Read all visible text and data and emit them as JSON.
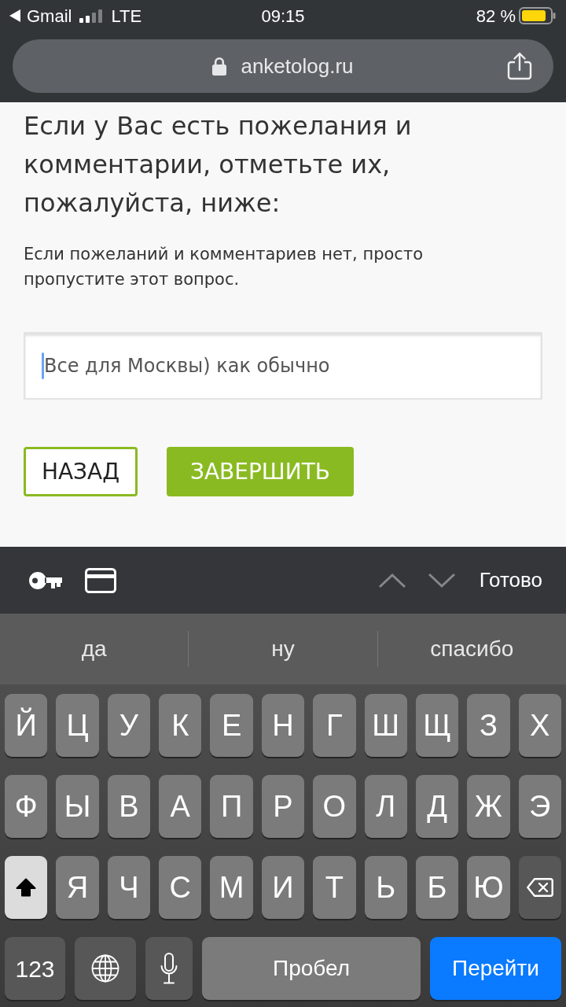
{
  "status_bar": {
    "back_app": "Gmail",
    "network": "LTE",
    "time": "09:15",
    "battery": "82 %"
  },
  "browser": {
    "url": "anketolog.ru",
    "secure": true
  },
  "question": {
    "title": "Если у Вас есть пожелания и комментарии, отметьте их, пожалуйста, ниже:",
    "hint": "Если пожеланий и комментариев нет, просто пропустите этот вопрос.",
    "answer": {
      "value": "Все для Москвы) как обычно",
      "focused": true
    }
  },
  "buttons": [
    {
      "label": "НАЗАД",
      "kind": "outline"
    },
    {
      "label": "ЗАВЕРШИТЬ",
      "kind": "filled"
    }
  ],
  "keyboard_toolbar": {
    "nav": [
      {
        "kind": "up",
        "disabled": true
      },
      {
        "kind": "down",
        "disabled": true
      }
    ],
    "done": "Готово"
  },
  "suggestions": [
    "да",
    "ну",
    "спасибо"
  ],
  "keyboard": {
    "rows": [
      [
        {
          "kind": "letter",
          "label": "Й"
        },
        {
          "kind": "letter",
          "label": "Ц"
        },
        {
          "kind": "letter",
          "label": "У"
        },
        {
          "kind": "letter",
          "label": "К"
        },
        {
          "kind": "letter",
          "label": "Е"
        },
        {
          "kind": "letter",
          "label": "Н"
        },
        {
          "kind": "letter",
          "label": "Г"
        },
        {
          "kind": "letter",
          "label": "Ш"
        },
        {
          "kind": "letter",
          "label": "Щ"
        },
        {
          "kind": "letter",
          "label": "З"
        },
        {
          "kind": "letter",
          "label": "Х"
        }
      ],
      [
        {
          "kind": "letter",
          "label": "Ф"
        },
        {
          "kind": "letter",
          "label": "Ы"
        },
        {
          "kind": "letter",
          "label": "В"
        },
        {
          "kind": "letter",
          "label": "А"
        },
        {
          "kind": "letter",
          "label": "П"
        },
        {
          "kind": "letter",
          "label": "Р"
        },
        {
          "kind": "letter",
          "label": "О"
        },
        {
          "kind": "letter",
          "label": "Л"
        },
        {
          "kind": "letter",
          "label": "Д"
        },
        {
          "kind": "letter",
          "label": "Ж"
        },
        {
          "kind": "letter",
          "label": "Э"
        }
      ],
      [
        {
          "kind": "shift",
          "on": true
        },
        {
          "kind": "letter",
          "label": "Я"
        },
        {
          "kind": "letter",
          "label": "Ч"
        },
        {
          "kind": "letter",
          "label": "С"
        },
        {
          "kind": "letter",
          "label": "М"
        },
        {
          "kind": "letter",
          "label": "И"
        },
        {
          "kind": "letter",
          "label": "Т"
        },
        {
          "kind": "letter",
          "label": "Ь"
        },
        {
          "kind": "letter",
          "label": "Б"
        },
        {
          "kind": "letter",
          "label": "Ю"
        },
        {
          "kind": "delete"
        }
      ]
    ],
    "bottom_row": [
      {
        "kind": "mode",
        "label": "123"
      },
      {
        "kind": "globe"
      },
      {
        "kind": "dictation"
      },
      {
        "kind": "space",
        "label": "Пробел"
      },
      {
        "kind": "return",
        "label": "Перейти"
      }
    ]
  }
}
